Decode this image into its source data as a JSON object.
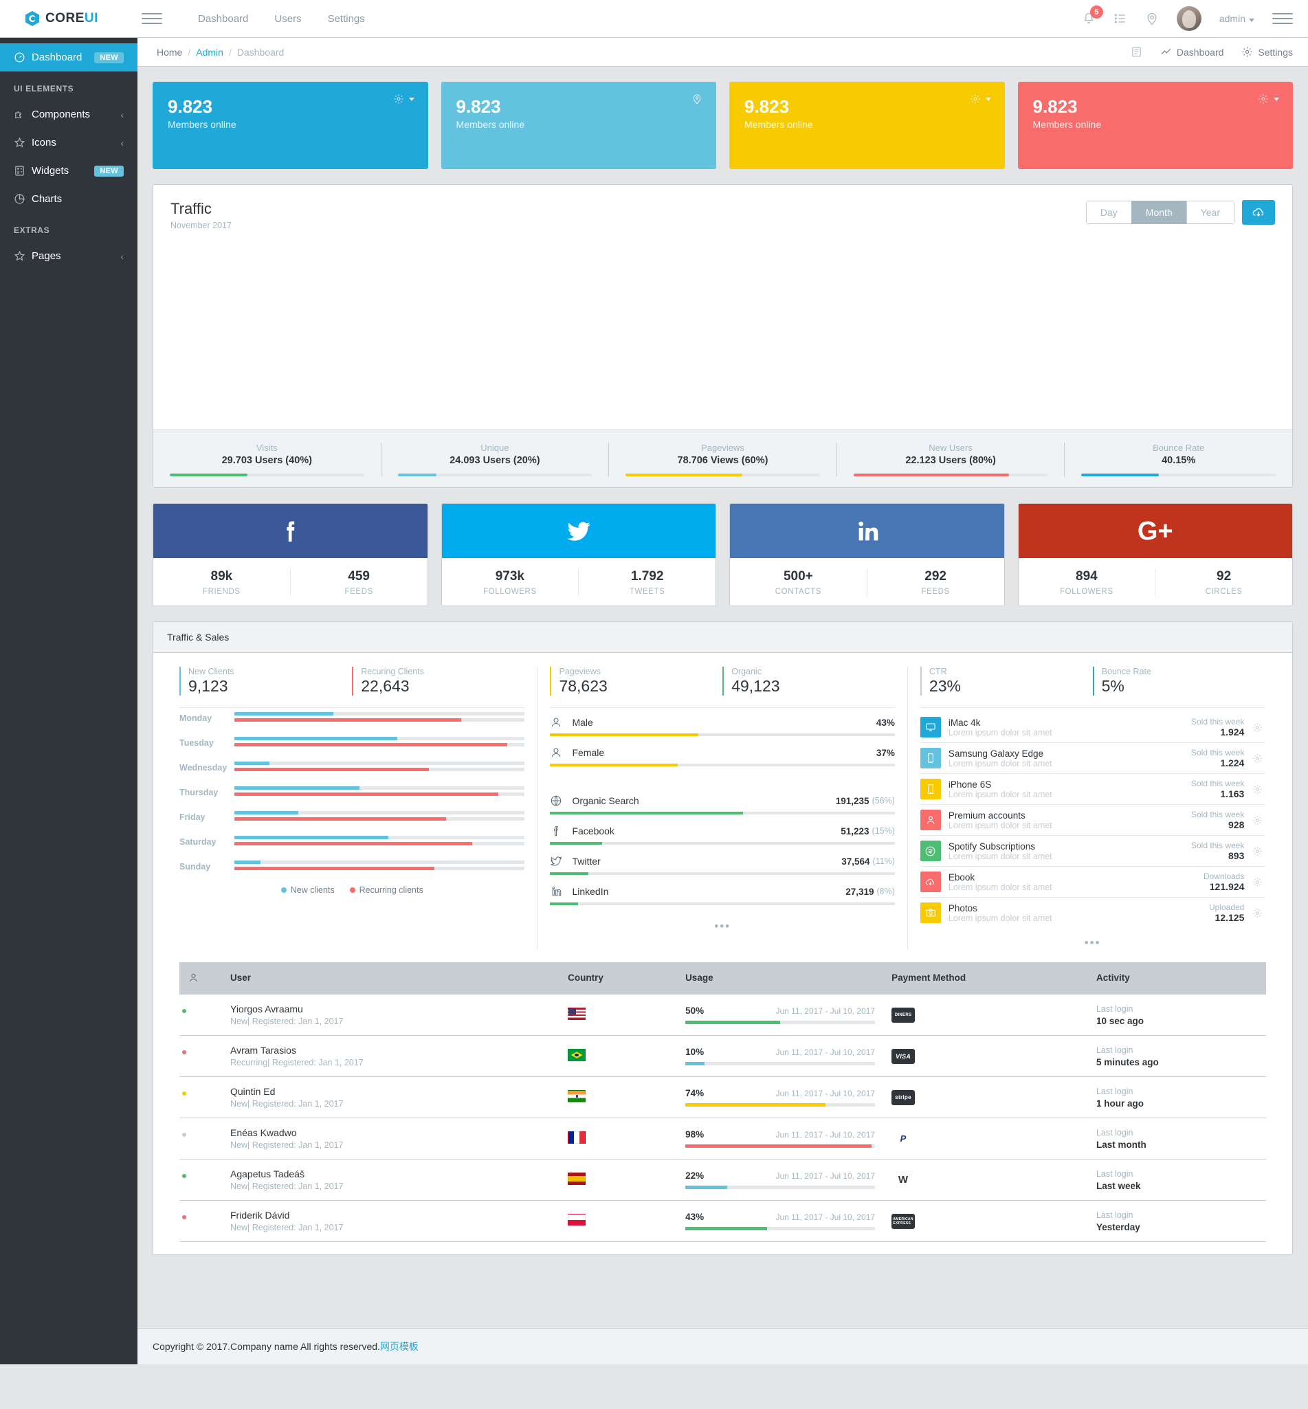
{
  "header": {
    "brand_core": "CORE",
    "brand_ui": "UI",
    "nav": [
      {
        "label": "Dashboard"
      },
      {
        "label": "Users"
      },
      {
        "label": "Settings"
      }
    ],
    "notification_count": "5",
    "user_label": "admin"
  },
  "sidebar": {
    "items": [
      {
        "label": "Dashboard",
        "icon": "speedometer-icon",
        "badge": "NEW",
        "badge_color": "#63c2de",
        "active": true
      },
      {
        "label": "Components",
        "icon": "puzzle-icon",
        "chevron": "‹"
      },
      {
        "label": "Icons",
        "icon": "star-icon",
        "chevron": "‹"
      },
      {
        "label": "Widgets",
        "icon": "calculator-icon",
        "badge": "NEW",
        "badge_color": "#63c2de"
      },
      {
        "label": "Charts",
        "icon": "pie-chart-icon"
      },
      {
        "label": "Pages",
        "icon": "star-icon",
        "chevron": "‹"
      }
    ],
    "title_ui_elements": "UI ELEMENTS",
    "title_extras": "EXTRAS"
  },
  "breadcrumb": {
    "home": "Home",
    "admin": "Admin",
    "current": "Dashboard",
    "right_links": [
      {
        "label": "Dashboard",
        "icon": "chart-line-icon"
      },
      {
        "label": "Settings",
        "icon": "gear-icon"
      }
    ]
  },
  "stat_cards": [
    {
      "value": "9.823",
      "label": "Members online",
      "color": "#20a8d8",
      "tools": "gear-caret"
    },
    {
      "value": "9.823",
      "label": "Members online",
      "color": "#63c2de",
      "tools": "location"
    },
    {
      "value": "9.823",
      "label": "Members online",
      "color": "#f8cb00",
      "tools": "gear-caret"
    },
    {
      "value": "9.823",
      "label": "Members online",
      "color": "#f86c6b",
      "tools": "gear-caret"
    }
  ],
  "traffic": {
    "title": "Traffic",
    "subtitle": "November 2017",
    "buttons": [
      {
        "label": "Day",
        "active": false
      },
      {
        "label": "Month",
        "active": true
      },
      {
        "label": "Year",
        "active": false
      }
    ],
    "download_icon": "cloud-download-icon",
    "footer": [
      {
        "label": "Visits",
        "value": "29.703 Users (40%)",
        "pct": 40,
        "color": "#4dbd74"
      },
      {
        "label": "Unique",
        "value": "24.093 Users (20%)",
        "pct": 20,
        "color": "#63c2de"
      },
      {
        "label": "Pageviews",
        "value": "78.706 Views (60%)",
        "pct": 60,
        "color": "#f8cb00"
      },
      {
        "label": "New Users",
        "value": "22.123 Users (80%)",
        "pct": 80,
        "color": "#f86c6b"
      },
      {
        "label": "Bounce Rate",
        "value": "40.15%",
        "pct": 40,
        "color": "#20a8d8"
      }
    ]
  },
  "social": [
    {
      "network": "facebook",
      "icon": "facebook-icon",
      "glyph": "f",
      "color": "#3b5998",
      "stats": [
        {
          "num": "89k",
          "cap": "FRIENDS"
        },
        {
          "num": "459",
          "cap": "FEEDS"
        }
      ]
    },
    {
      "network": "twitter",
      "icon": "twitter-icon",
      "glyph": "",
      "color": "#00aced",
      "stats": [
        {
          "num": "973k",
          "cap": "FOLLOWERS"
        },
        {
          "num": "1.792",
          "cap": "TWEETS"
        }
      ]
    },
    {
      "network": "linkedin",
      "icon": "linkedin-icon",
      "glyph": "in",
      "color": "#4875b4",
      "stats": [
        {
          "num": "500+",
          "cap": "CONTACTS"
        },
        {
          "num": "292",
          "cap": "FEEDS"
        }
      ]
    },
    {
      "network": "google-plus",
      "icon": "google-plus-icon",
      "glyph": "G+",
      "color": "#c0341d",
      "stats": [
        {
          "num": "894",
          "cap": "FOLLOWERS"
        },
        {
          "num": "92",
          "cap": "CIRCLES"
        }
      ]
    }
  ],
  "traffic_sales": {
    "header": "Traffic & Sales",
    "kpis_left": [
      {
        "label": "New Clients",
        "value": "9,123",
        "color": "#63c2de"
      },
      {
        "label": "Recuring Clients",
        "value": "22,643",
        "color": "#f86c6b"
      }
    ],
    "kpis_mid": [
      {
        "label": "Pageviews",
        "value": "78,623",
        "color": "#f8cb00"
      },
      {
        "label": "Organic",
        "value": "49,123",
        "color": "#4dbd74"
      }
    ],
    "kpis_right": [
      {
        "label": "CTR",
        "value": "23%",
        "color": "#c8ced3"
      },
      {
        "label": "Bounce Rate",
        "value": "5%",
        "color": "#20a8d8"
      }
    ],
    "days": [
      {
        "label": "Monday",
        "new": 34,
        "recurring": 78
      },
      {
        "label": "Tuesday",
        "new": 56,
        "recurring": 94
      },
      {
        "label": "Wednesday",
        "new": 12,
        "recurring": 67
      },
      {
        "label": "Thursday",
        "new": 43,
        "recurring": 91
      },
      {
        "label": "Friday",
        "new": 22,
        "recurring": 73
      },
      {
        "label": "Saturday",
        "new": 53,
        "recurring": 82
      },
      {
        "label": "Sunday",
        "new": 9,
        "recurring": 69
      }
    ],
    "legend": [
      {
        "label": "New clients",
        "color": "#63c2de"
      },
      {
        "label": "Recurring clients",
        "color": "#f86c6b"
      }
    ],
    "gender": [
      {
        "label": "Male",
        "icon": "user-male-icon",
        "value": "43%",
        "pct": 43,
        "color": "#f8cb00"
      },
      {
        "label": "Female",
        "icon": "user-female-icon",
        "value": "37%",
        "pct": 37,
        "color": "#f8cb00"
      }
    ],
    "sources": [
      {
        "label": "Organic Search",
        "icon": "globe-icon",
        "value": "191,235",
        "pct_label": "(56%)",
        "pct": 56,
        "color": "#4dbd74"
      },
      {
        "label": "Facebook",
        "icon": "facebook-icon",
        "value": "51,223",
        "pct_label": "(15%)",
        "pct": 15,
        "color": "#4dbd74"
      },
      {
        "label": "Twitter",
        "icon": "twitter-icon",
        "value": "37,564",
        "pct_label": "(11%)",
        "pct": 11,
        "color": "#4dbd74"
      },
      {
        "label": "LinkedIn",
        "icon": "linkedin-icon",
        "value": "27,319",
        "pct_label": "(8%)",
        "pct": 8,
        "color": "#4dbd74"
      }
    ],
    "products": [
      {
        "name": "iMac 4k",
        "desc": "Lorem ipsum dolor sit amet",
        "meta_label": "Sold this week",
        "meta_value": "1.924",
        "icon": "monitor-icon",
        "color": "#20a8d8"
      },
      {
        "name": "Samsung Galaxy Edge",
        "desc": "Lorem ipsum dolor sit amet",
        "meta_label": "Sold this week",
        "meta_value": "1.224",
        "icon": "phone-icon",
        "color": "#63c2de"
      },
      {
        "name": "iPhone 6S",
        "desc": "Lorem ipsum dolor sit amet",
        "meta_label": "Sold this week",
        "meta_value": "1.163",
        "icon": "phone-icon",
        "color": "#f8cb00"
      },
      {
        "name": "Premium accounts",
        "desc": "Lorem ipsum dolor sit amet",
        "meta_label": "Sold this week",
        "meta_value": "928",
        "icon": "user-icon",
        "color": "#f86c6b"
      },
      {
        "name": "Spotify Subscriptions",
        "desc": "Lorem ipsum dolor sit amet",
        "meta_label": "Sold this week",
        "meta_value": "893",
        "icon": "spotify-icon",
        "color": "#4dbd74"
      },
      {
        "name": "Ebook",
        "desc": "Lorem ipsum dolor sit amet",
        "meta_label": "Downloads",
        "meta_value": "121.924",
        "icon": "cloud-download-icon",
        "color": "#f86c6b"
      },
      {
        "name": "Photos",
        "desc": "Lorem ipsum dolor sit amet",
        "meta_label": "Uploaded",
        "meta_value": "12.125",
        "icon": "camera-icon",
        "color": "#f8cb00"
      }
    ],
    "more_dots": "•••"
  },
  "users_table": {
    "columns": [
      "",
      "User",
      "Country",
      "Usage",
      "Payment Method",
      "Activity"
    ],
    "activity_label": "Last login",
    "date_range": "Jun 11, 2017 - Jul 10, 2017",
    "rows": [
      {
        "name": "Yiorgos Avraamu",
        "sub": "New| Registered: Jan 1, 2017",
        "country": "USA",
        "usage": "50%",
        "pct": 50,
        "bar_color": "#4dbd74",
        "payment": "DINERS CLUB",
        "payment_icon": "diners-club-icon",
        "activity": "10 sec ago",
        "status_color": "#4dbd74",
        "avatar_color": "#8d7b6e"
      },
      {
        "name": "Avram Tarasios",
        "sub": "Recurring| Registered: Jan 1, 2017",
        "country": "Brazil",
        "usage": "10%",
        "pct": 10,
        "bar_color": "#63c2de",
        "payment": "VISA",
        "payment_icon": "visa-icon",
        "activity": "5 minutes ago",
        "status_color": "#f86c6b",
        "avatar_color": "#9c7f72"
      },
      {
        "name": "Quintin Ed",
        "sub": "New| Registered: Jan 1, 2017",
        "country": "India",
        "usage": "74%",
        "pct": 74,
        "bar_color": "#f8cb00",
        "payment": "stripe",
        "payment_icon": "stripe-icon",
        "activity": "1 hour ago",
        "status_color": "#f8cb00",
        "avatar_color": "#6f6d70"
      },
      {
        "name": "Enéas Kwadwo",
        "sub": "New| Registered: Jan 1, 2017",
        "country": "France",
        "usage": "98%",
        "pct": 98,
        "bar_color": "#f86c6b",
        "payment": "PayPal",
        "payment_icon": "paypal-icon",
        "activity": "Last month",
        "status_color": "#c8ced3",
        "avatar_color": "#b0808a"
      },
      {
        "name": "Agapetus Tadeáš",
        "sub": "New| Registered: Jan 1, 2017",
        "country": "Spain",
        "usage": "22%",
        "pct": 22,
        "bar_color": "#63c2de",
        "payment": "Western Union",
        "payment_icon": "western-union-icon",
        "activity": "Last week",
        "status_color": "#4dbd74",
        "avatar_color": "#a8795a"
      },
      {
        "name": "Friderik Dávid",
        "sub": "New| Registered: Jan 1, 2017",
        "country": "Poland",
        "usage": "43%",
        "pct": 43,
        "bar_color": "#4dbd74",
        "payment": "AMEX",
        "payment_icon": "amex-icon",
        "activity": "Yesterday",
        "status_color": "#f86c6b",
        "avatar_color": "#8e9398"
      }
    ]
  },
  "footer": {
    "copyright": "Copyright © 2017.Company name All rights reserved.",
    "link": "网页模板"
  }
}
